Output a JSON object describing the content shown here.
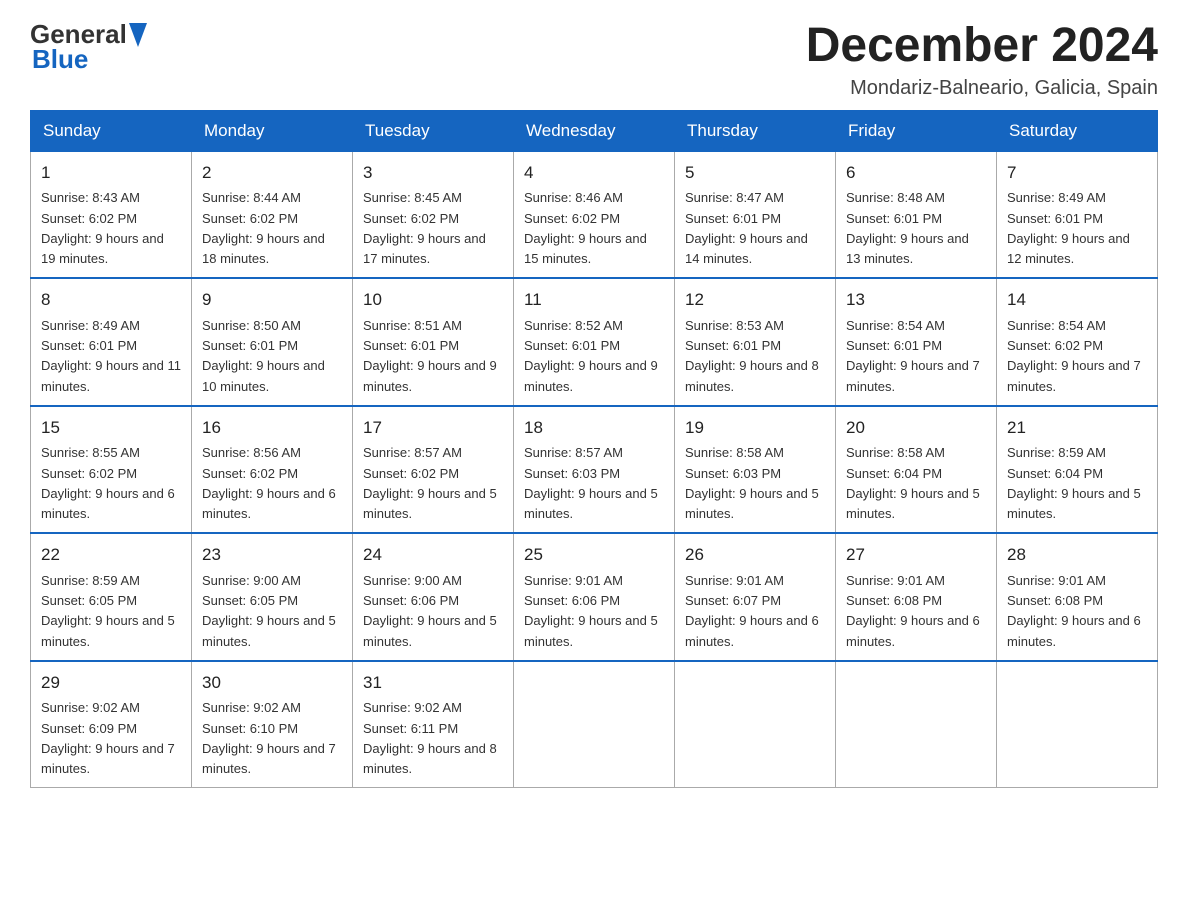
{
  "logo": {
    "text_general": "General",
    "text_blue": "Blue"
  },
  "title": "December 2024",
  "location": "Mondariz-Balneario, Galicia, Spain",
  "days_of_week": [
    "Sunday",
    "Monday",
    "Tuesday",
    "Wednesday",
    "Thursday",
    "Friday",
    "Saturday"
  ],
  "weeks": [
    [
      {
        "day": "1",
        "sunrise": "8:43 AM",
        "sunset": "6:02 PM",
        "daylight": "9 hours and 19 minutes."
      },
      {
        "day": "2",
        "sunrise": "8:44 AM",
        "sunset": "6:02 PM",
        "daylight": "9 hours and 18 minutes."
      },
      {
        "day": "3",
        "sunrise": "8:45 AM",
        "sunset": "6:02 PM",
        "daylight": "9 hours and 17 minutes."
      },
      {
        "day": "4",
        "sunrise": "8:46 AM",
        "sunset": "6:02 PM",
        "daylight": "9 hours and 15 minutes."
      },
      {
        "day": "5",
        "sunrise": "8:47 AM",
        "sunset": "6:01 PM",
        "daylight": "9 hours and 14 minutes."
      },
      {
        "day": "6",
        "sunrise": "8:48 AM",
        "sunset": "6:01 PM",
        "daylight": "9 hours and 13 minutes."
      },
      {
        "day": "7",
        "sunrise": "8:49 AM",
        "sunset": "6:01 PM",
        "daylight": "9 hours and 12 minutes."
      }
    ],
    [
      {
        "day": "8",
        "sunrise": "8:49 AM",
        "sunset": "6:01 PM",
        "daylight": "9 hours and 11 minutes."
      },
      {
        "day": "9",
        "sunrise": "8:50 AM",
        "sunset": "6:01 PM",
        "daylight": "9 hours and 10 minutes."
      },
      {
        "day": "10",
        "sunrise": "8:51 AM",
        "sunset": "6:01 PM",
        "daylight": "9 hours and 9 minutes."
      },
      {
        "day": "11",
        "sunrise": "8:52 AM",
        "sunset": "6:01 PM",
        "daylight": "9 hours and 9 minutes."
      },
      {
        "day": "12",
        "sunrise": "8:53 AM",
        "sunset": "6:01 PM",
        "daylight": "9 hours and 8 minutes."
      },
      {
        "day": "13",
        "sunrise": "8:54 AM",
        "sunset": "6:01 PM",
        "daylight": "9 hours and 7 minutes."
      },
      {
        "day": "14",
        "sunrise": "8:54 AM",
        "sunset": "6:02 PM",
        "daylight": "9 hours and 7 minutes."
      }
    ],
    [
      {
        "day": "15",
        "sunrise": "8:55 AM",
        "sunset": "6:02 PM",
        "daylight": "9 hours and 6 minutes."
      },
      {
        "day": "16",
        "sunrise": "8:56 AM",
        "sunset": "6:02 PM",
        "daylight": "9 hours and 6 minutes."
      },
      {
        "day": "17",
        "sunrise": "8:57 AM",
        "sunset": "6:02 PM",
        "daylight": "9 hours and 5 minutes."
      },
      {
        "day": "18",
        "sunrise": "8:57 AM",
        "sunset": "6:03 PM",
        "daylight": "9 hours and 5 minutes."
      },
      {
        "day": "19",
        "sunrise": "8:58 AM",
        "sunset": "6:03 PM",
        "daylight": "9 hours and 5 minutes."
      },
      {
        "day": "20",
        "sunrise": "8:58 AM",
        "sunset": "6:04 PM",
        "daylight": "9 hours and 5 minutes."
      },
      {
        "day": "21",
        "sunrise": "8:59 AM",
        "sunset": "6:04 PM",
        "daylight": "9 hours and 5 minutes."
      }
    ],
    [
      {
        "day": "22",
        "sunrise": "8:59 AM",
        "sunset": "6:05 PM",
        "daylight": "9 hours and 5 minutes."
      },
      {
        "day": "23",
        "sunrise": "9:00 AM",
        "sunset": "6:05 PM",
        "daylight": "9 hours and 5 minutes."
      },
      {
        "day": "24",
        "sunrise": "9:00 AM",
        "sunset": "6:06 PM",
        "daylight": "9 hours and 5 minutes."
      },
      {
        "day": "25",
        "sunrise": "9:01 AM",
        "sunset": "6:06 PM",
        "daylight": "9 hours and 5 minutes."
      },
      {
        "day": "26",
        "sunrise": "9:01 AM",
        "sunset": "6:07 PM",
        "daylight": "9 hours and 6 minutes."
      },
      {
        "day": "27",
        "sunrise": "9:01 AM",
        "sunset": "6:08 PM",
        "daylight": "9 hours and 6 minutes."
      },
      {
        "day": "28",
        "sunrise": "9:01 AM",
        "sunset": "6:08 PM",
        "daylight": "9 hours and 6 minutes."
      }
    ],
    [
      {
        "day": "29",
        "sunrise": "9:02 AM",
        "sunset": "6:09 PM",
        "daylight": "9 hours and 7 minutes."
      },
      {
        "day": "30",
        "sunrise": "9:02 AM",
        "sunset": "6:10 PM",
        "daylight": "9 hours and 7 minutes."
      },
      {
        "day": "31",
        "sunrise": "9:02 AM",
        "sunset": "6:11 PM",
        "daylight": "9 hours and 8 minutes."
      },
      null,
      null,
      null,
      null
    ]
  ]
}
